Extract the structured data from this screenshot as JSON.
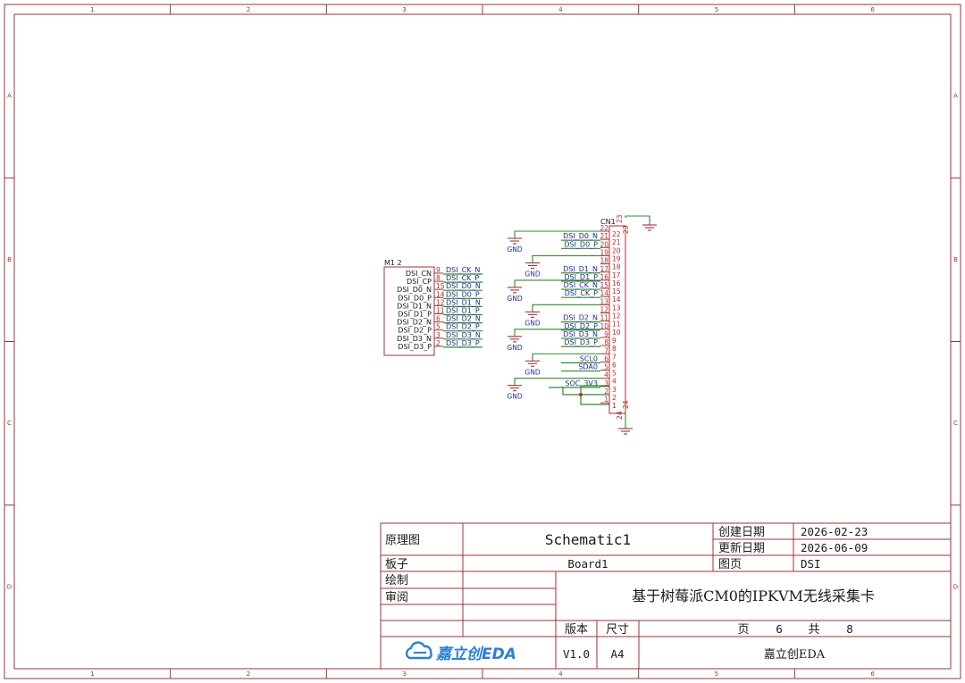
{
  "ruler": {
    "columns": [
      "1",
      "2",
      "3",
      "4",
      "5",
      "6"
    ],
    "rows": [
      "A",
      "B",
      "C",
      "D"
    ]
  },
  "m1": {
    "designator": "M1 2",
    "pins": [
      {
        "name": "DSI_CN",
        "num": "9",
        "net": "DSI_CK_N"
      },
      {
        "name": "DSI_CP",
        "num": "8",
        "net": "DSI_CK_P"
      },
      {
        "name": "DSI_D0_N",
        "num": "15",
        "net": "DSI_D0_N"
      },
      {
        "name": "DSI_D0_P",
        "num": "14",
        "net": "DSI_D0_P"
      },
      {
        "name": "DSI_D1_N",
        "num": "12",
        "net": "DSI_D1_N"
      },
      {
        "name": "DSI_D1_P",
        "num": "11",
        "net": "DSI_D1_P"
      },
      {
        "name": "DSI_D2_N",
        "num": "6",
        "net": "DSI_D2_N"
      },
      {
        "name": "DSI_D2_P",
        "num": "5",
        "net": "DSI_D2_P"
      },
      {
        "name": "DSI_D3_N",
        "num": "3",
        "net": "DSI_D3_N"
      },
      {
        "name": "DSI_D3_P",
        "num": "2",
        "net": "DSI_D3_P"
      }
    ]
  },
  "cn1": {
    "designator": "CN1",
    "top_pin": "23",
    "bottom_pin": "24",
    "pins": [
      {
        "num": "22",
        "label": "",
        "inner": "22"
      },
      {
        "num": "21",
        "label": "DSI_D0_N",
        "inner": "21"
      },
      {
        "num": "20",
        "label": "DSI_D0_P",
        "inner": "20"
      },
      {
        "num": "19",
        "label": "",
        "inner": "19"
      },
      {
        "num": "18",
        "label": "",
        "inner": "18"
      },
      {
        "num": "17",
        "label": "DSI_D1_N",
        "inner": "17"
      },
      {
        "num": "16",
        "label": "DSI_D1_P",
        "inner": "16"
      },
      {
        "num": "15",
        "label": "DSI_CK_N",
        "inner": "15"
      },
      {
        "num": "14",
        "label": "DSI_CK_P",
        "inner": "14"
      },
      {
        "num": "13",
        "label": "",
        "inner": "13"
      },
      {
        "num": "12",
        "label": "",
        "inner": "12"
      },
      {
        "num": "11",
        "label": "DSI_D2_N",
        "inner": "11"
      },
      {
        "num": "10",
        "label": "DSI_D2_P",
        "inner": "10"
      },
      {
        "num": "9",
        "label": "DSI_D3_N",
        "inner": "9"
      },
      {
        "num": "8",
        "label": "DSI_D3_P",
        "inner": "8"
      },
      {
        "num": "7",
        "label": "",
        "inner": "7"
      },
      {
        "num": "6",
        "label": "SCL0",
        "inner": "6"
      },
      {
        "num": "5",
        "label": "SDA0",
        "inner": "5"
      },
      {
        "num": "4",
        "label": "",
        "inner": "4"
      },
      {
        "num": "3",
        "label": "SOC_3V3",
        "inner": "3"
      },
      {
        "num": "2",
        "label": "",
        "inner": "2"
      },
      {
        "num": "1",
        "label": "",
        "inner": "1"
      }
    ],
    "gnd_label": "GND"
  },
  "title_block": {
    "schematic_label": "原理图",
    "schematic_name": "Schematic1",
    "board_label": "板子",
    "board_name": "Board1",
    "created_label": "创建日期",
    "created_date": "2026-02-23",
    "updated_label": "更新日期",
    "updated_date": "2026-06-09",
    "sheet_label": "图页",
    "sheet_name": "DSI",
    "drawn_label": "绘制",
    "review_label": "审阅",
    "title": "基于树莓派CM0的IPKVM无线采集卡",
    "version_label": "版本",
    "version": "V1.0",
    "size_label": "尺寸",
    "size": "A4",
    "page_label": "页",
    "page": "6",
    "total_label": "共",
    "total": "8",
    "company": "嘉立创EDA",
    "logo_text": "嘉立创EDA"
  }
}
